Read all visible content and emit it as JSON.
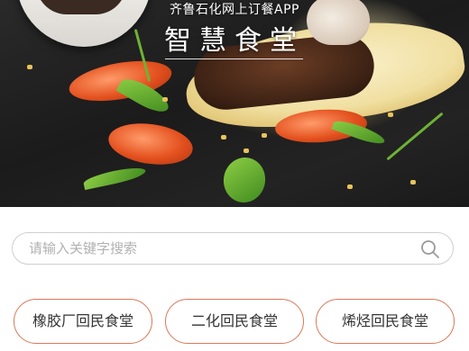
{
  "header": {
    "subtitle": "齐鲁石化网上订餐APP",
    "title": "智慧食堂"
  },
  "search": {
    "placeholder": "请输入关键字搜索",
    "value": "",
    "icon": "search-icon"
  },
  "canteens": [
    {
      "label": "橡胶厂回民食堂"
    },
    {
      "label": "二化回民食堂"
    },
    {
      "label": "烯烃回民食堂"
    }
  ],
  "colors": {
    "button_border": "#d9785a",
    "search_border": "#cfcfcf",
    "placeholder": "#b1b1b1"
  }
}
